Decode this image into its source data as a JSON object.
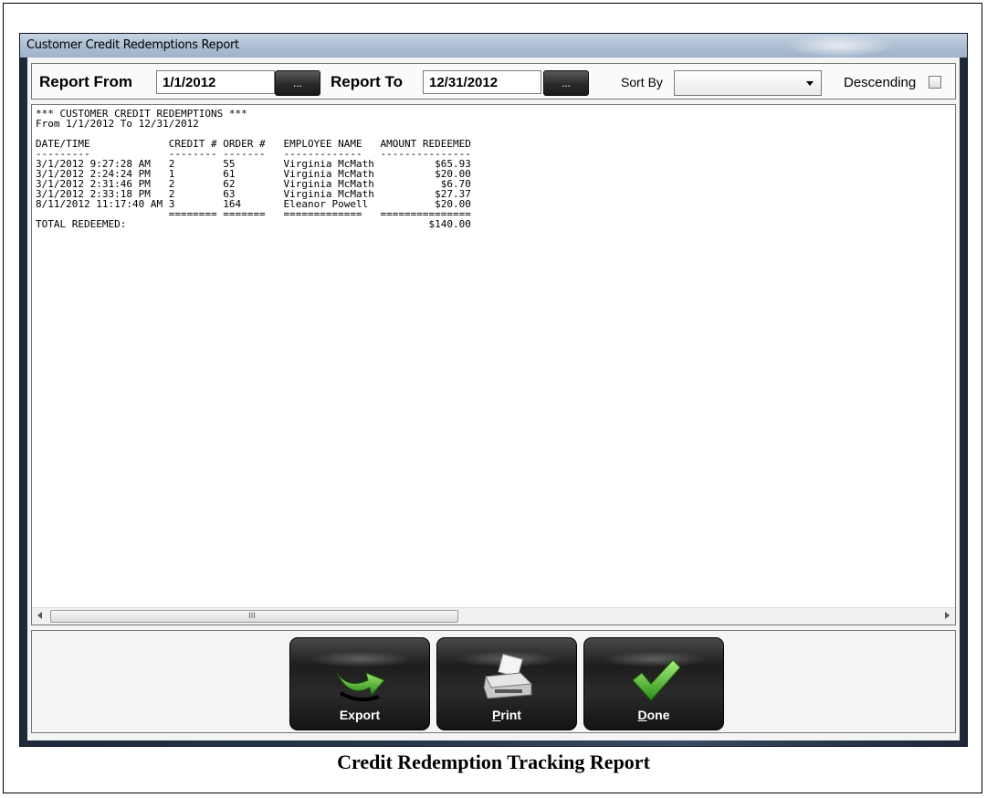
{
  "window": {
    "title": "Customer Credit Redemptions Report"
  },
  "filters": {
    "report_from_label": "Report From",
    "report_from_value": "1/1/2012",
    "report_to_label": "Report To",
    "report_to_value": "12/31/2012",
    "picker_label": "...",
    "sort_by_label": "Sort By",
    "sort_by_value": "",
    "descending_label": "Descending",
    "descending_checked": false
  },
  "report": {
    "title_line": "*** CUSTOMER CREDIT REDEMPTIONS ***",
    "range_line": "From 1/1/2012 To 12/31/2012",
    "columns": [
      "DATE/TIME",
      "CREDIT #",
      "ORDER #",
      "EMPLOYEE NAME",
      "AMOUNT REDEEMED"
    ],
    "rows": [
      [
        "3/1/2012 9:27:28 AM",
        "2",
        "55",
        "Virginia McMath",
        "$65.93"
      ],
      [
        "3/1/2012 2:24:24 PM",
        "1",
        "61",
        "Virginia McMath",
        "$20.00"
      ],
      [
        "3/1/2012 2:31:46 PM",
        "2",
        "62",
        "Virginia McMath",
        "$6.70"
      ],
      [
        "3/1/2012 2:33:18 PM",
        "2",
        "63",
        "Virginia McMath",
        "$27.37"
      ],
      [
        "8/11/2012 11:17:40 AM",
        "3",
        "164",
        "Eleanor Powell",
        "$20.00"
      ]
    ],
    "total_label": "TOTAL REDEEMED:",
    "total_value": "$140.00"
  },
  "actions": {
    "export_label": "Export",
    "print_label": "Print",
    "done_label": "Done"
  },
  "caption": "Credit Redemption Tracking Report"
}
